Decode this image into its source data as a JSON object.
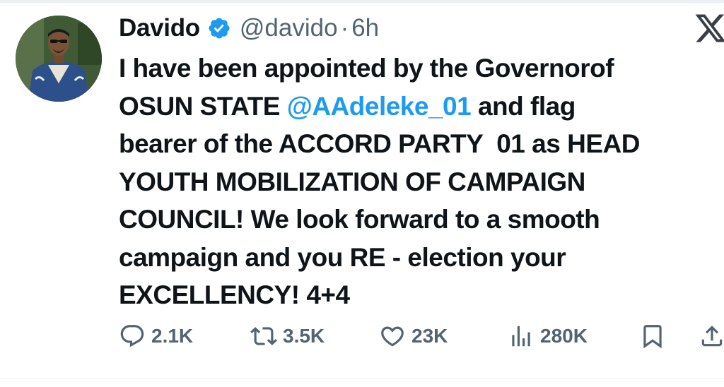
{
  "author": {
    "display_name": "Davido",
    "handle": "@davido",
    "separator": "·",
    "time": "6h",
    "verified": true
  },
  "tweet": {
    "lines": [
      [
        {
          "text": "I have been appointed by the Governorof"
        }
      ],
      [
        {
          "text": "OSUN STATE "
        },
        {
          "text": "@AAdeleke_01",
          "mention": true
        },
        {
          "text": " and flag"
        }
      ],
      [
        {
          "text": "bearer of the ACCORD PARTY  01 as HEAD"
        }
      ],
      [
        {
          "text": "YOUTH MOBILIZATION OF CAMPAIGN"
        }
      ],
      [
        {
          "text": "COUNCIL! We look forward to a smooth"
        }
      ],
      [
        {
          "text": "campaign and you RE - election your"
        }
      ],
      [
        {
          "text": "EXCELLENCY! 4+4"
        }
      ]
    ]
  },
  "actions": {
    "replies": "2.1K",
    "reposts": "3.5K",
    "likes": "23K",
    "views": "280K"
  },
  "colors": {
    "text": "#0f1419",
    "secondary": "#536471",
    "mention": "#1d9bf0",
    "verified_badge": "#1d9bf0"
  },
  "icons": {
    "platform": "x-logo-icon",
    "verified": "verified-badge-icon",
    "reply": "reply-icon",
    "repost": "repost-icon",
    "like": "like-icon",
    "views": "views-icon",
    "bookmark": "bookmark-icon",
    "share": "share-icon"
  }
}
